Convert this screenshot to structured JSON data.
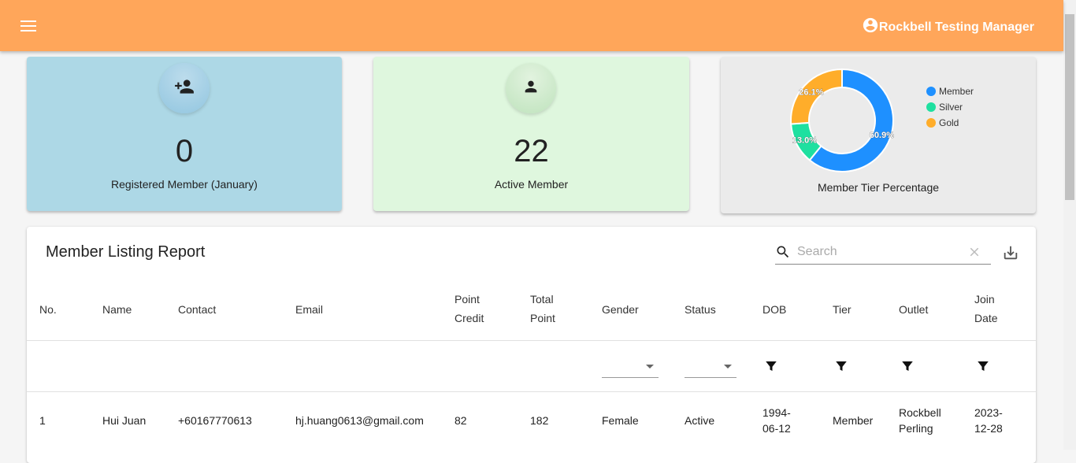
{
  "header": {
    "menu_icon": "menu-icon",
    "user_icon": "account-circle-icon",
    "user_name": "Rockbell Testing Manager"
  },
  "cards": {
    "registered": {
      "value": "0",
      "label": "Registered Member (January)",
      "icon": "person-add-icon",
      "color": "#add8e6"
    },
    "active": {
      "value": "22",
      "label": "Active Member",
      "icon": "person-icon",
      "color": "#dff7de"
    },
    "tier": {
      "label": "Member Tier Percentage"
    }
  },
  "chart_data": {
    "type": "pie",
    "title": "Member Tier Percentage",
    "legend": "right",
    "slices": [
      {
        "name": "Member",
        "value": 60.9,
        "label": "60.9%",
        "color": "#1e90ff"
      },
      {
        "name": "Silver",
        "value": 13.0,
        "label": "13.0%",
        "color": "#1ee0a0"
      },
      {
        "name": "Gold",
        "value": 26.1,
        "label": "26.1%",
        "color": "#ffad2a"
      }
    ]
  },
  "report": {
    "title": "Member Listing Report",
    "search_placeholder": "Search",
    "columns": {
      "no": "No.",
      "name": "Name",
      "contact": "Contact",
      "email": "Email",
      "point_credit_1": "Point",
      "point_credit_2": "Credit",
      "total_point_1": "Total",
      "total_point_2": "Point",
      "gender": "Gender",
      "status": "Status",
      "dob": "DOB",
      "tier": "Tier",
      "outlet": "Outlet",
      "join_date_1": "Join",
      "join_date_2": "Date"
    },
    "rows": [
      {
        "no": "1",
        "name": "Hui Juan",
        "contact": "+60167770613",
        "email": "hj.huang0613@gmail.com",
        "point_credit": "82",
        "total_point": "182",
        "gender": "Female",
        "status": "Active",
        "dob_1": "1994-",
        "dob_2": "06-12",
        "tier": "Member",
        "outlet_1": "Rockbell",
        "outlet_2": "Perling",
        "join_1": "2023-",
        "join_2": "12-28"
      }
    ]
  }
}
